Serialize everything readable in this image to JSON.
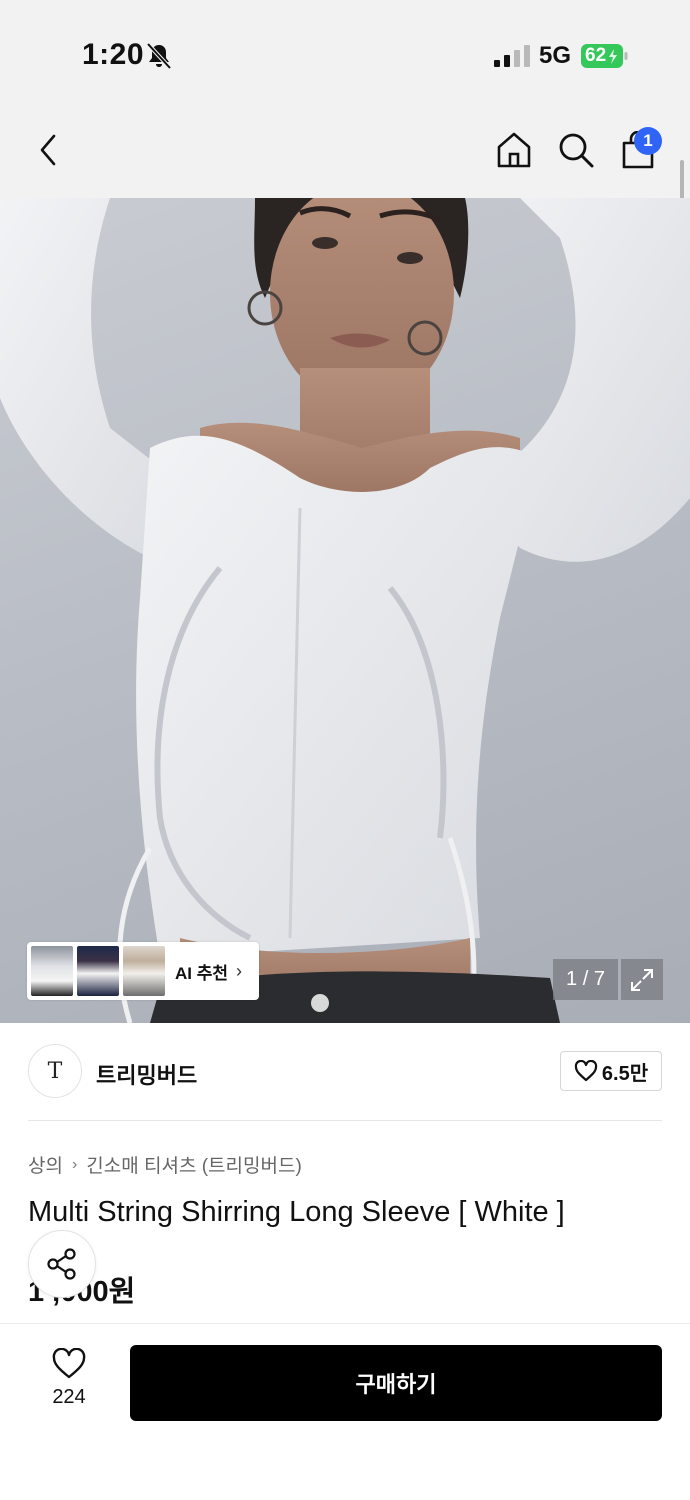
{
  "status_bar": {
    "time": "1:20",
    "network": "5G",
    "battery": "62"
  },
  "header": {
    "cart_count": "1",
    "icons": [
      "back-icon",
      "home-icon",
      "search-icon",
      "shopping-bag-icon"
    ]
  },
  "gallery": {
    "ai_recommend_label": "AI 추천",
    "counter": "1 / 7"
  },
  "brand": {
    "logo_text": "T",
    "name": "트리밍버드",
    "like_count": "6.5만"
  },
  "product": {
    "breadcrumb": [
      "상의",
      "긴소매 티셔츠 (트리밍버드)"
    ],
    "title": "Multi String Shirring Long Sleeve [ White ]",
    "price": "1 ,000원"
  },
  "bottom_bar": {
    "like_count": "224",
    "buy_label": "구매하기"
  },
  "colors": {
    "badge": "#2f64f5",
    "battery": "#34c759",
    "buy_button": "#000000"
  }
}
